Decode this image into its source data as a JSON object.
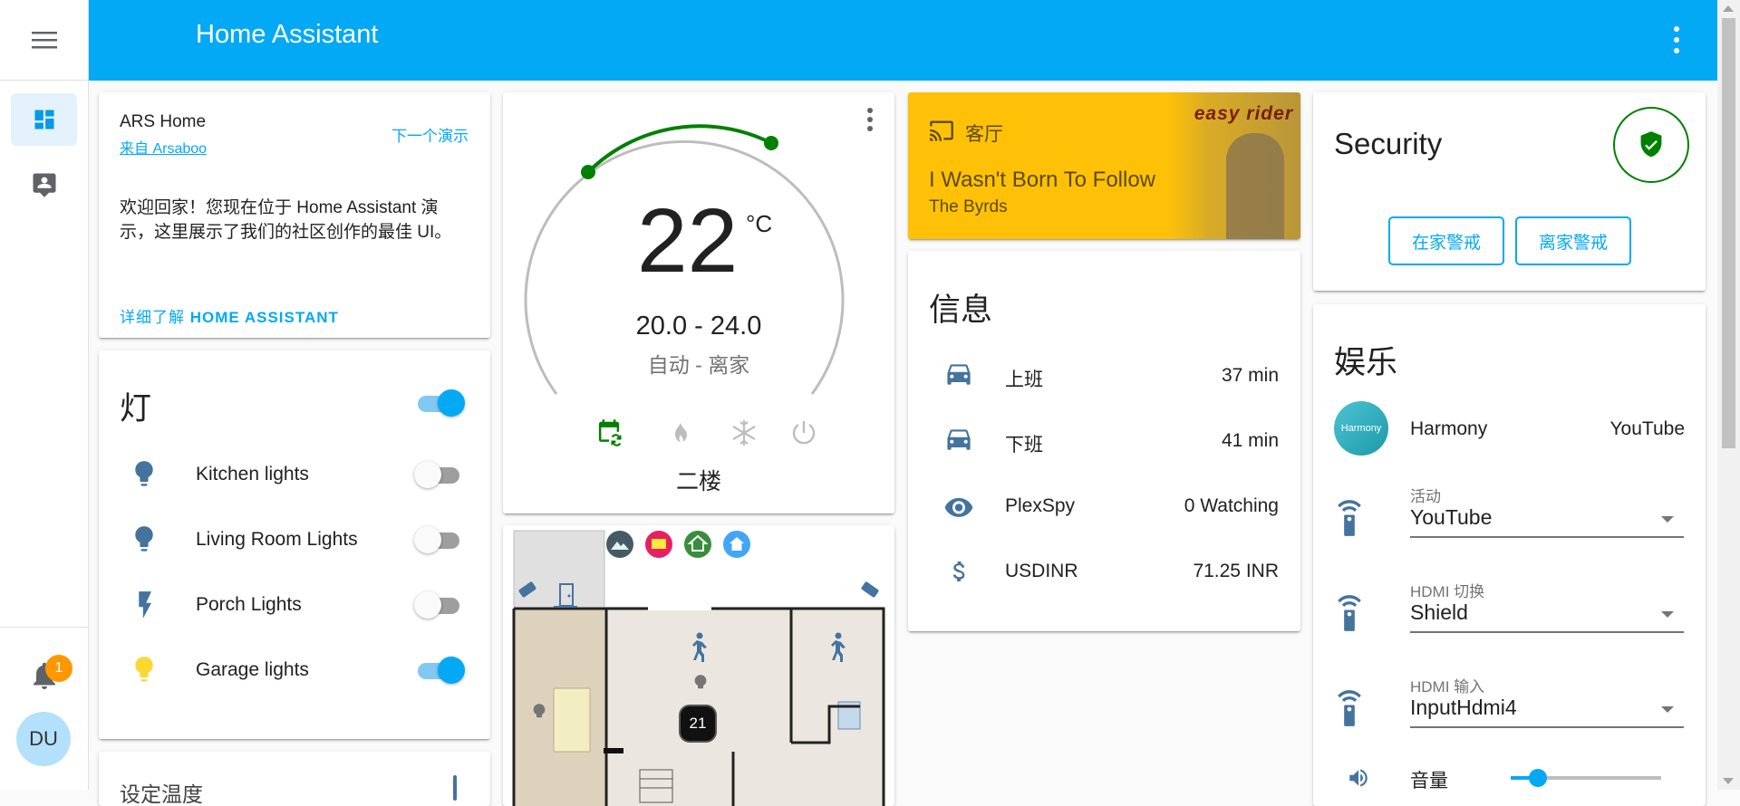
{
  "app": {
    "title": "Home Assistant"
  },
  "user": {
    "initials": "DU",
    "notifications": "1"
  },
  "welcome": {
    "title": "ARS Home",
    "source": "来自 Arsaboo",
    "next_demo": "下一个演示",
    "body": "欢迎回家！您现在位于 Home Assistant 演示，这里展示了我们的社区创作的最佳 UI。",
    "learn_more_prefix": "详细了解 ",
    "learn_more_bold": "HOME ASSISTANT"
  },
  "lights": {
    "title": "灯",
    "master_on": true,
    "items": [
      {
        "label": "Kitchen lights",
        "on": false,
        "icon": "bulb-icon"
      },
      {
        "label": "Living Room Lights",
        "on": false,
        "icon": "bulb-icon"
      },
      {
        "label": "Porch Lights",
        "on": false,
        "icon": "flash-icon"
      },
      {
        "label": "Garage lights",
        "on": true,
        "icon": "bulb-icon"
      }
    ]
  },
  "next_card": {
    "title": "设定温度"
  },
  "thermostat": {
    "temp": "22",
    "unit": "°C",
    "range": "20.0 - 24.0",
    "mode": "自动 - 离家",
    "name": "二楼",
    "low": 20.0,
    "high": 24.0,
    "modes": [
      "calendar-sync-icon",
      "fire-icon",
      "snowflake-icon",
      "power-icon"
    ],
    "active_color": "#008000"
  },
  "floorplan": {
    "thermostat_value": "21"
  },
  "media": {
    "room": "客厅",
    "track": "I Wasn't Born To Follow",
    "artist": "The Byrds",
    "art_title": "easy rider",
    "background": "#ffc107"
  },
  "info": {
    "title": "信息",
    "items": [
      {
        "icon": "car-icon",
        "label": "上班",
        "value": "37 min"
      },
      {
        "icon": "car-icon",
        "label": "下班",
        "value": "41 min"
      },
      {
        "icon": "eye-icon",
        "label": "PlexSpy",
        "value": "0 Watching"
      },
      {
        "icon": "dollar-icon",
        "label": "USDINR",
        "value": "71.25 INR"
      }
    ]
  },
  "security": {
    "title": "Security",
    "arm_home": "在家警戒",
    "arm_away": "离家警戒",
    "status_color": "#008000"
  },
  "entertainment": {
    "title": "娱乐",
    "harmony": {
      "logo": "Harmony",
      "name": "Harmony",
      "state": "YouTube"
    },
    "selects": [
      {
        "caption": "活动",
        "value": "YouTube"
      },
      {
        "caption": "HDMI 切换",
        "value": "Shield"
      },
      {
        "caption": "HDMI 输入",
        "value": "InputHdmi4"
      }
    ],
    "volume_label": "音量",
    "volume_level": 0.18
  }
}
